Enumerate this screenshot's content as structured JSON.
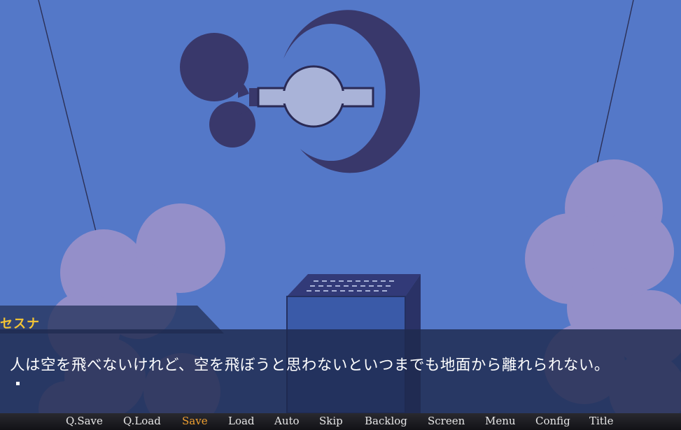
{
  "dialogue": {
    "speaker": "セスナ",
    "text": "人は空を飛べないけれど、空を飛ぼうと思わないといつまでも地面から離れられない。",
    "wait_cursor": "white-square-icon"
  },
  "menu": {
    "items": [
      {
        "label": "Q.Save"
      },
      {
        "label": "Q.Load"
      },
      {
        "label": "Save",
        "active": true
      },
      {
        "label": "Load"
      },
      {
        "label": "Auto"
      },
      {
        "label": "Skip"
      },
      {
        "label": "Backlog"
      },
      {
        "label": "Screen"
      },
      {
        "label": "Menu"
      },
      {
        "label": "Config"
      },
      {
        "label": "Title"
      }
    ],
    "active_color": "#f0a030",
    "text_color": "#e6e6e6"
  },
  "colors": {
    "sky": "#5478c8",
    "emblem": "#39386b",
    "planet": "#a9b3d8",
    "cloud": "#948fc9",
    "speaker_name": "#f4c534"
  }
}
